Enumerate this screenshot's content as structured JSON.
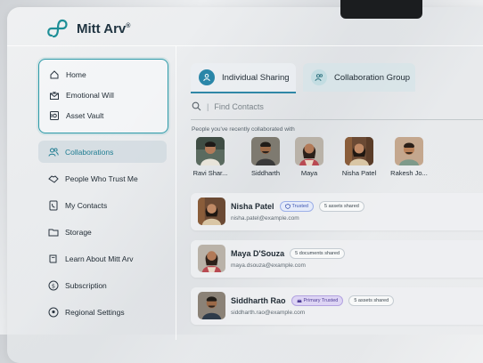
{
  "app": {
    "name": "Mitt Arv",
    "trademark": "®"
  },
  "sidebar": {
    "top_items": [
      {
        "label": "Home",
        "icon": "home-icon"
      },
      {
        "label": "Emotional Will",
        "icon": "heart-mail-icon"
      },
      {
        "label": "Asset Vault",
        "icon": "vault-icon"
      }
    ],
    "items": [
      {
        "label": "Collaborations",
        "icon": "people-icon",
        "active": true
      },
      {
        "label": "People Who Trust Me",
        "icon": "handshake-icon"
      },
      {
        "label": "My Contacts",
        "icon": "phone-book-icon"
      },
      {
        "label": "Storage",
        "icon": "folder-icon"
      },
      {
        "label": "Learn About Mitt Arv",
        "icon": "book-icon"
      },
      {
        "label": "Subscription",
        "icon": "dollar-icon"
      },
      {
        "label": "Regional Settings",
        "icon": "location-icon"
      }
    ]
  },
  "tabs": [
    {
      "label": "Individual Sharing",
      "active": true
    },
    {
      "label": "Collaboration Group",
      "active": false
    }
  ],
  "search": {
    "placeholder": "Find Contacts"
  },
  "recent": {
    "label": "People you've recently collaborated with",
    "people": [
      {
        "name": "Ravi Shar..."
      },
      {
        "name": "Siddharth"
      },
      {
        "name": "Maya"
      },
      {
        "name": "Nisha Patel"
      },
      {
        "name": "Rakesh Jo..."
      }
    ]
  },
  "contacts": [
    {
      "name": "Nisha Patel",
      "email": "nisha.patel@example.com",
      "badges": [
        "Trusted",
        "5 assets shared"
      ]
    },
    {
      "name": "Maya D'Souza",
      "email": "maya.dsouza@example.com",
      "badges": [
        "5 documents shared"
      ]
    },
    {
      "name": "Siddharth Rao",
      "email": "siddharth.rao@example.com",
      "badges": [
        "Primary Trusted",
        "5 assets shared"
      ]
    }
  ],
  "colors": {
    "accent": "#2f87a6",
    "brand_teal": "#2d9aa8",
    "trusted": "#3e56b0",
    "primary_trusted": "#4e3d96"
  }
}
